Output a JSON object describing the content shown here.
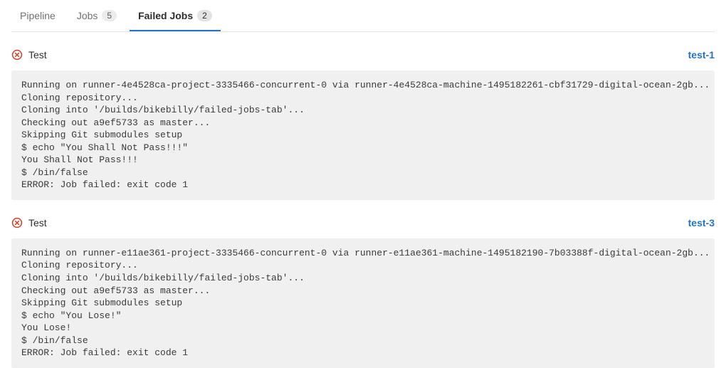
{
  "tabs": [
    {
      "label": "Pipeline",
      "count": null,
      "active": false
    },
    {
      "label": "Jobs",
      "count": "5",
      "active": false
    },
    {
      "label": "Failed Jobs",
      "count": "2",
      "active": true
    }
  ],
  "jobs": [
    {
      "stage": "Test",
      "name": "test-1",
      "log": "Running on runner-4e4528ca-project-3335466-concurrent-0 via runner-4e4528ca-machine-1495182261-cbf31729-digital-ocean-2gb...\nCloning repository...\nCloning into '/builds/bikebilly/failed-jobs-tab'...\nChecking out a9ef5733 as master...\nSkipping Git submodules setup\n$ echo \"You Shall Not Pass!!!\"\nYou Shall Not Pass!!!\n$ /bin/false\nERROR: Job failed: exit code 1"
    },
    {
      "stage": "Test",
      "name": "test-3",
      "log": "Running on runner-e11ae361-project-3335466-concurrent-0 via runner-e11ae361-machine-1495182190-7b03388f-digital-ocean-2gb...\nCloning repository...\nCloning into '/builds/bikebilly/failed-jobs-tab'...\nChecking out a9ef5733 as master...\nSkipping Git submodules setup\n$ echo \"You Lose!\"\nYou Lose!\n$ /bin/false\nERROR: Job failed: exit code 1"
    }
  ]
}
